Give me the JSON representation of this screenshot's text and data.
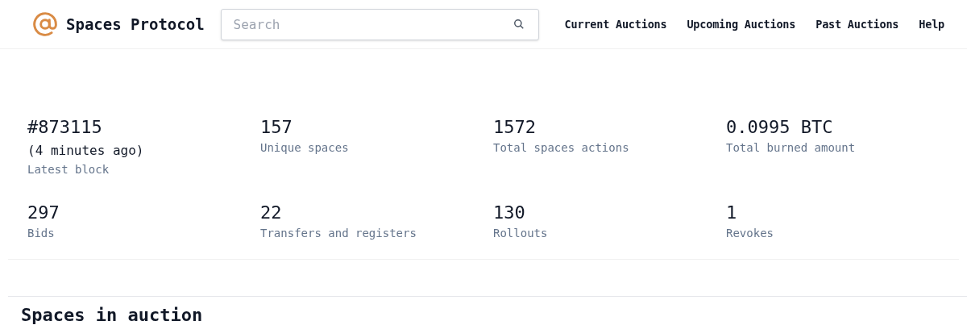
{
  "header": {
    "logo_text": "Spaces Protocol",
    "search": {
      "placeholder": "Search"
    },
    "nav": [
      "Current Auctions",
      "Upcoming Auctions",
      "Past Auctions",
      "Help"
    ]
  },
  "stats": [
    {
      "value": "#873115",
      "note": "(4 minutes ago)",
      "label": "Latest block"
    },
    {
      "value": "157",
      "label": "Unique spaces"
    },
    {
      "value": "1572",
      "label": "Total spaces actions"
    },
    {
      "value": "0.0995 BTC",
      "label": "Total burned amount"
    },
    {
      "value": "297",
      "label": "Bids"
    },
    {
      "value": "22",
      "label": "Transfers and registers"
    },
    {
      "value": "130",
      "label": "Rollouts"
    },
    {
      "value": "1",
      "label": "Revokes"
    }
  ],
  "section_title": "Spaces in auction"
}
